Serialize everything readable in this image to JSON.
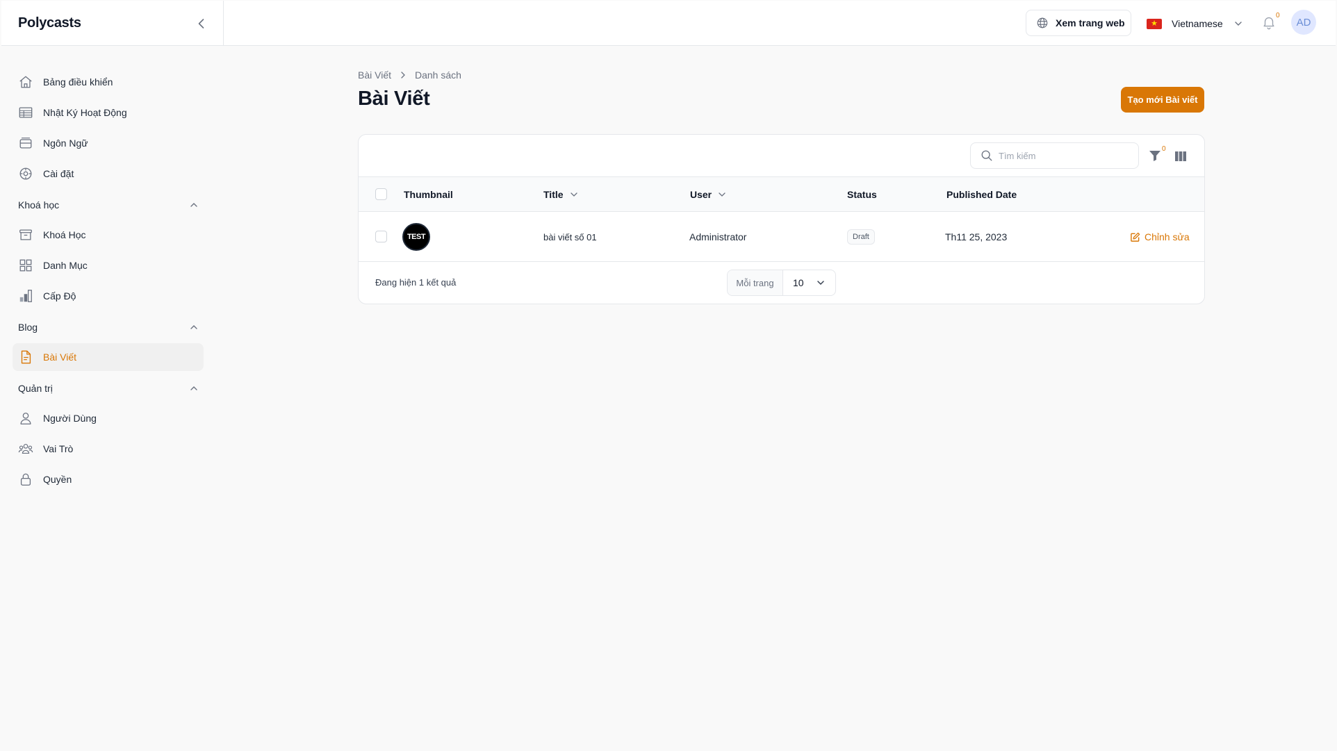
{
  "app": {
    "brand": "Polycasts"
  },
  "header": {
    "view_site_label": "Xem trang web",
    "language_label": "Vietnamese",
    "notification_count": "0",
    "avatar_initials": "AD"
  },
  "sidebar": {
    "items": [
      {
        "label": "Bảng điều khiển",
        "icon": "home-icon"
      },
      {
        "label": "Nhật Ký Hoạt Động",
        "icon": "table-icon"
      },
      {
        "label": "Ngôn Ngữ",
        "icon": "inbox-icon"
      },
      {
        "label": "Cài đặt",
        "icon": "settings-icon"
      }
    ],
    "groups": [
      {
        "label": "Khoá học",
        "items": [
          {
            "label": "Khoá Học",
            "icon": "archive-icon"
          },
          {
            "label": "Danh Mục",
            "icon": "grid-icon"
          },
          {
            "label": "Cấp Độ",
            "icon": "bar-chart-icon"
          }
        ]
      },
      {
        "label": "Blog",
        "items": [
          {
            "label": "Bài Viết",
            "icon": "document-icon",
            "active": true
          }
        ]
      },
      {
        "label": "Quản trị",
        "items": [
          {
            "label": "Người Dùng",
            "icon": "user-icon"
          },
          {
            "label": "Vai Trò",
            "icon": "users-icon"
          },
          {
            "label": "Quyền",
            "icon": "lock-icon"
          }
        ]
      }
    ]
  },
  "main": {
    "breadcrumb": [
      "Bài Viết",
      "Danh sách"
    ],
    "title": "Bài Viết",
    "create_label": "Tạo mới Bài viết",
    "search_placeholder": "Tìm kiếm",
    "filter_count": "0",
    "columns": [
      "Thumbnail",
      "Title",
      "User",
      "Status",
      "Published Date"
    ],
    "rows": [
      {
        "thumbnail_text": "TEST",
        "title": "bài viết số 01",
        "user": "Administrator",
        "status": "Draft",
        "published_date": "Th11 25, 2023",
        "action_label": "Chỉnh sửa"
      }
    ],
    "result_text": "Đang hiện 1 kết quả",
    "per_page_label": "Mỗi trang",
    "per_page_value": "10"
  },
  "colors": {
    "accent": "#d97706",
    "background": "#f9f9f9"
  }
}
